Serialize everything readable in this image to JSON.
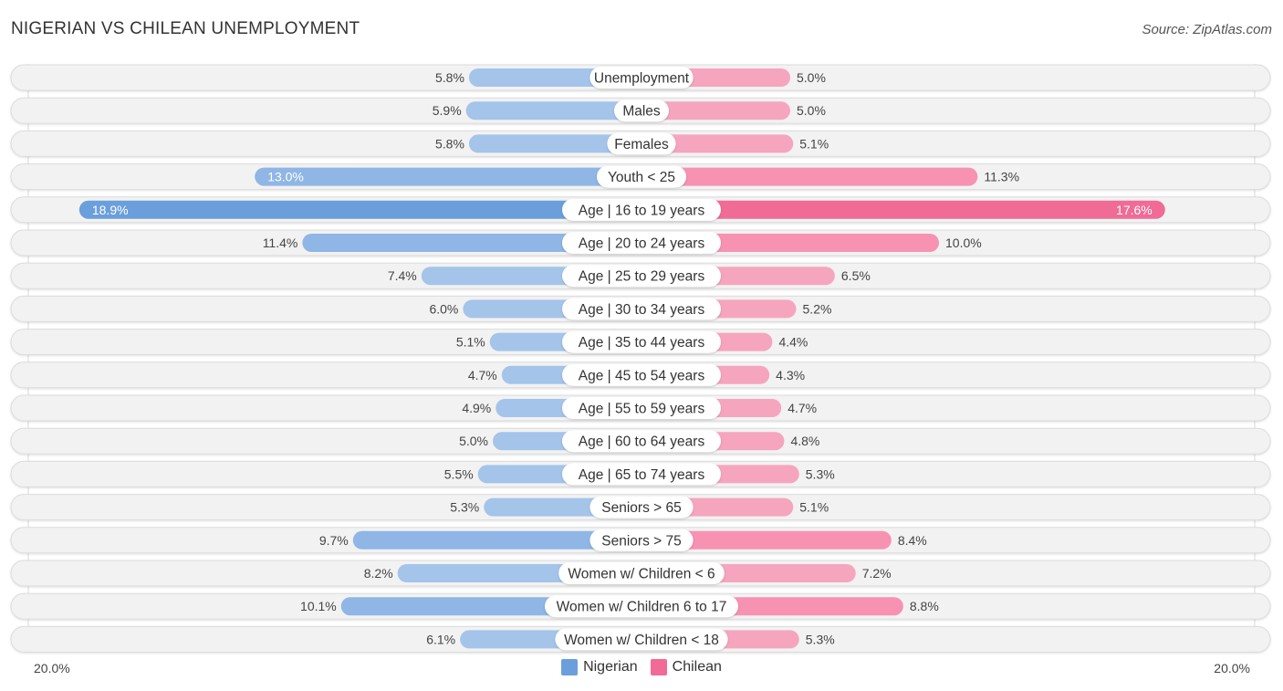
{
  "header": {
    "title": "NIGERIAN VS CHILEAN UNEMPLOYMENT",
    "source": "Source: ZipAtlas.com"
  },
  "colors": {
    "nigerian_light": "#a4c4ea",
    "nigerian_strong": "#6a9fdc",
    "chilean_light": "#f6a5bf",
    "chilean_strong": "#f06b96",
    "row_bg": "#f2f2f2",
    "row_border": "#dcdcdc"
  },
  "legend": {
    "items": [
      {
        "label": "Nigerian",
        "color": "#6a9fdc"
      },
      {
        "label": "Chilean",
        "color": "#f06b96"
      }
    ]
  },
  "axis": {
    "left_label": "20.0%",
    "right_label": "20.0%"
  },
  "chart_data": {
    "type": "bar",
    "orientation": "horizontal-diverging",
    "title": "NIGERIAN VS CHILEAN UNEMPLOYMENT",
    "xlim": [
      0,
      20
    ],
    "unit": "%",
    "legend_position": "bottom-center",
    "categories": [
      "Unemployment",
      "Males",
      "Females",
      "Youth < 25",
      "Age | 16 to 19 years",
      "Age | 20 to 24 years",
      "Age | 25 to 29 years",
      "Age | 30 to 34 years",
      "Age | 35 to 44 years",
      "Age | 45 to 54 years",
      "Age | 55 to 59 years",
      "Age | 60 to 64 years",
      "Age | 65 to 74 years",
      "Seniors > 65",
      "Seniors > 75",
      "Women w/ Children < 6",
      "Women w/ Children 6 to 17",
      "Women w/ Children < 18"
    ],
    "series": [
      {
        "name": "Nigerian",
        "side": "left",
        "values": [
          5.8,
          5.9,
          5.8,
          13.0,
          18.9,
          11.4,
          7.4,
          6.0,
          5.1,
          4.7,
          4.9,
          5.0,
          5.5,
          5.3,
          9.7,
          8.2,
          10.1,
          6.1
        ],
        "labels": [
          "5.8%",
          "5.9%",
          "5.8%",
          "13.0%",
          "18.9%",
          "11.4%",
          "7.4%",
          "6.0%",
          "5.1%",
          "4.7%",
          "4.9%",
          "5.0%",
          "5.5%",
          "5.3%",
          "9.7%",
          "8.2%",
          "10.1%",
          "6.1%"
        ]
      },
      {
        "name": "Chilean",
        "side": "right",
        "values": [
          5.0,
          5.0,
          5.1,
          11.3,
          17.6,
          10.0,
          6.5,
          5.2,
          4.4,
          4.3,
          4.7,
          4.8,
          5.3,
          5.1,
          8.4,
          7.2,
          8.8,
          5.3
        ],
        "labels": [
          "5.0%",
          "5.0%",
          "5.1%",
          "11.3%",
          "17.6%",
          "10.0%",
          "6.5%",
          "5.2%",
          "4.4%",
          "4.3%",
          "4.7%",
          "4.8%",
          "5.3%",
          "5.1%",
          "8.4%",
          "7.2%",
          "8.8%",
          "5.3%"
        ]
      }
    ]
  }
}
